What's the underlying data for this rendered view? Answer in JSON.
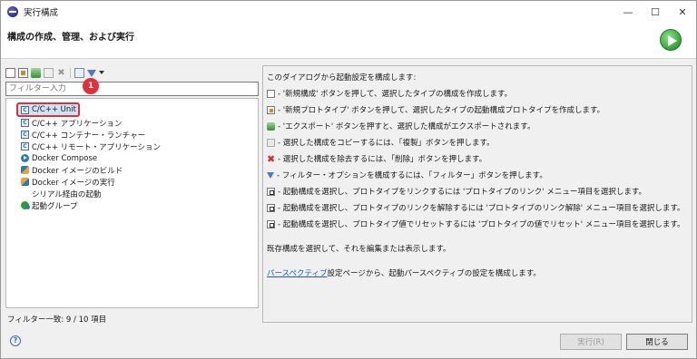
{
  "window": {
    "title": "実行構成",
    "controls": {
      "minimize": "—",
      "maximize": "☐",
      "close": "✕"
    }
  },
  "header": {
    "title": "構成の作成、管理、および実行"
  },
  "toolbar": {
    "icons": [
      "new-config-icon",
      "new-prototype-icon",
      "export-icon",
      "duplicate-icon",
      "delete-icon",
      "collapse-all-icon",
      "filter-icon",
      "view-menu-icon"
    ]
  },
  "filter": {
    "placeholder": "フィルター入力",
    "value": ""
  },
  "annotation": {
    "badge": "1"
  },
  "tree": {
    "items": [
      {
        "label": "C/C++ Unit",
        "icon": "c-unit-icon",
        "selected": true
      },
      {
        "label": "C/C++ アプリケーション",
        "icon": "c-app-icon"
      },
      {
        "label": "C/C++ コンテナー・ランチャー",
        "icon": "c-container-icon"
      },
      {
        "label": "C/C++ リモート・アプリケーション",
        "icon": "c-remote-icon"
      },
      {
        "label": "Docker Compose",
        "icon": "docker-compose-icon"
      },
      {
        "label": "Docker イメージのビルド",
        "icon": "docker-build-icon"
      },
      {
        "label": "Docker イメージの実行",
        "icon": "docker-run-icon"
      },
      {
        "label": "シリアル経由の起動",
        "icon": "none"
      },
      {
        "label": "起動グループ",
        "icon": "launch-group-icon"
      }
    ]
  },
  "status": {
    "filter_matches": "フィルター一致: 9 / 10 項目"
  },
  "help": {
    "intro": "このダイアログから起動設定を構成します:",
    "lines": [
      "- '新規構成' ボタンを押して、選択したタイプの構成を作成します。",
      "- '新規プロトタイプ' ボタンを押して、選択したタイプの起動構成プロトタイプを作成します。",
      "- 'エクスポート' ボタンを押すと、選択した構成がエクスポートされます。",
      "- 選択した構成をコピーするには、「複製」ボタンを押します。",
      "- 選択した構成を除去するには、「削除」ボタンを押します。",
      "- フィルター・オプションを構成するには、「フィルター」ボタンを押します。",
      "- 起動構成を選択し、プロトタイプをリンクするには 'プロトタイプのリンク' メニュー項目を選択します。",
      "- 起動構成を選択し、プロトタイプのリンクを解除するには 'プロトタイプのリンク解除' メニュー項目を選択します。",
      "- 起動構成を選択し、プロトタイプ値でリセットするには 'プロトタイプの値でリセット' メニュー項目を選択します。"
    ],
    "edit_hint": "既存構成を選択して、それを編集または表示します。",
    "perspective_link": "パースペクティブ",
    "perspective_text": "設定ページから、起動パースペクティブの設定を構成します。"
  },
  "footer": {
    "help_symbol": "?",
    "run_label": "実行(R)",
    "close_label": "閉じる"
  }
}
